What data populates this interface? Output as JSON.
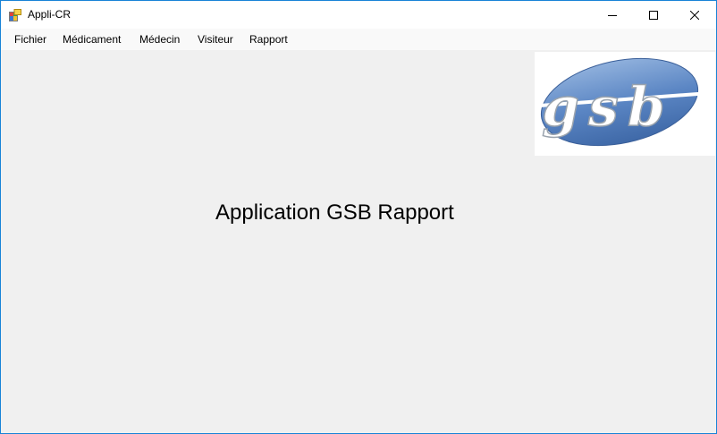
{
  "window": {
    "title": "Appli-CR",
    "icon": "windows-forms-app-icon",
    "controls": {
      "minimize_icon": "minimize-icon",
      "maximize_icon": "maximize-icon",
      "close_icon": "close-icon"
    }
  },
  "menu": {
    "items": [
      {
        "label": "Fichier"
      },
      {
        "label": "Médicament"
      },
      {
        "label": "Médecin"
      },
      {
        "label": "Visiteur"
      },
      {
        "label": "Rapport"
      }
    ]
  },
  "main": {
    "logo": {
      "text": "gsb",
      "icon": "gsb-logo"
    },
    "app_label": "Application GSB Rapport"
  },
  "colors": {
    "window_border": "#1883d7",
    "client_background": "#f0f0f0",
    "logo_blue": "#4a78b8"
  }
}
